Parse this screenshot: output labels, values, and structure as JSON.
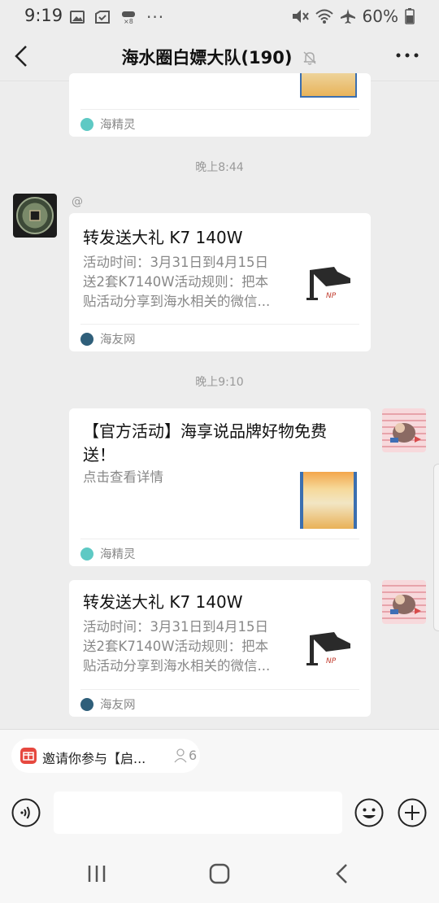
{
  "status_bar": {
    "time": "9:19",
    "battery_text": "60%",
    "more_dots": "···"
  },
  "header": {
    "title": "海水圈白嫖大队(190)"
  },
  "messages": [
    {
      "source": "海精灵"
    },
    {
      "timestamp": "晚上8:44"
    },
    {
      "sender": "@",
      "title": "转发送大礼 K7 140W",
      "desc_line1": "活动时间：3月31日到4月15日",
      "desc_line2": "送2套K7140W活动规则：把本",
      "desc_line3": "贴活动分享到海水相关的微信...",
      "source": "海友网"
    },
    {
      "timestamp": "晚上9:10"
    },
    {
      "title_line1": "【官方活动】海享说品牌好物免费",
      "title_line2": "送！",
      "desc": "点击查看详情",
      "source": "海精灵"
    },
    {
      "title": "转发送大礼 K7 140W",
      "desc_line1": "活动时间：3月31日到4月15日",
      "desc_line2": "送2套K7140W活动规则：把本",
      "desc_line3": "贴活动分享到海水相关的微信...",
      "source": "海友网"
    }
  ],
  "invite": {
    "text": "邀请你参与【启...",
    "count": "6"
  },
  "input": {
    "placeholder": ""
  },
  "colors": {
    "background": "#ededed",
    "bubble": "#ffffff",
    "muted_text": "#888888",
    "invite_icon": "#e6483f"
  }
}
